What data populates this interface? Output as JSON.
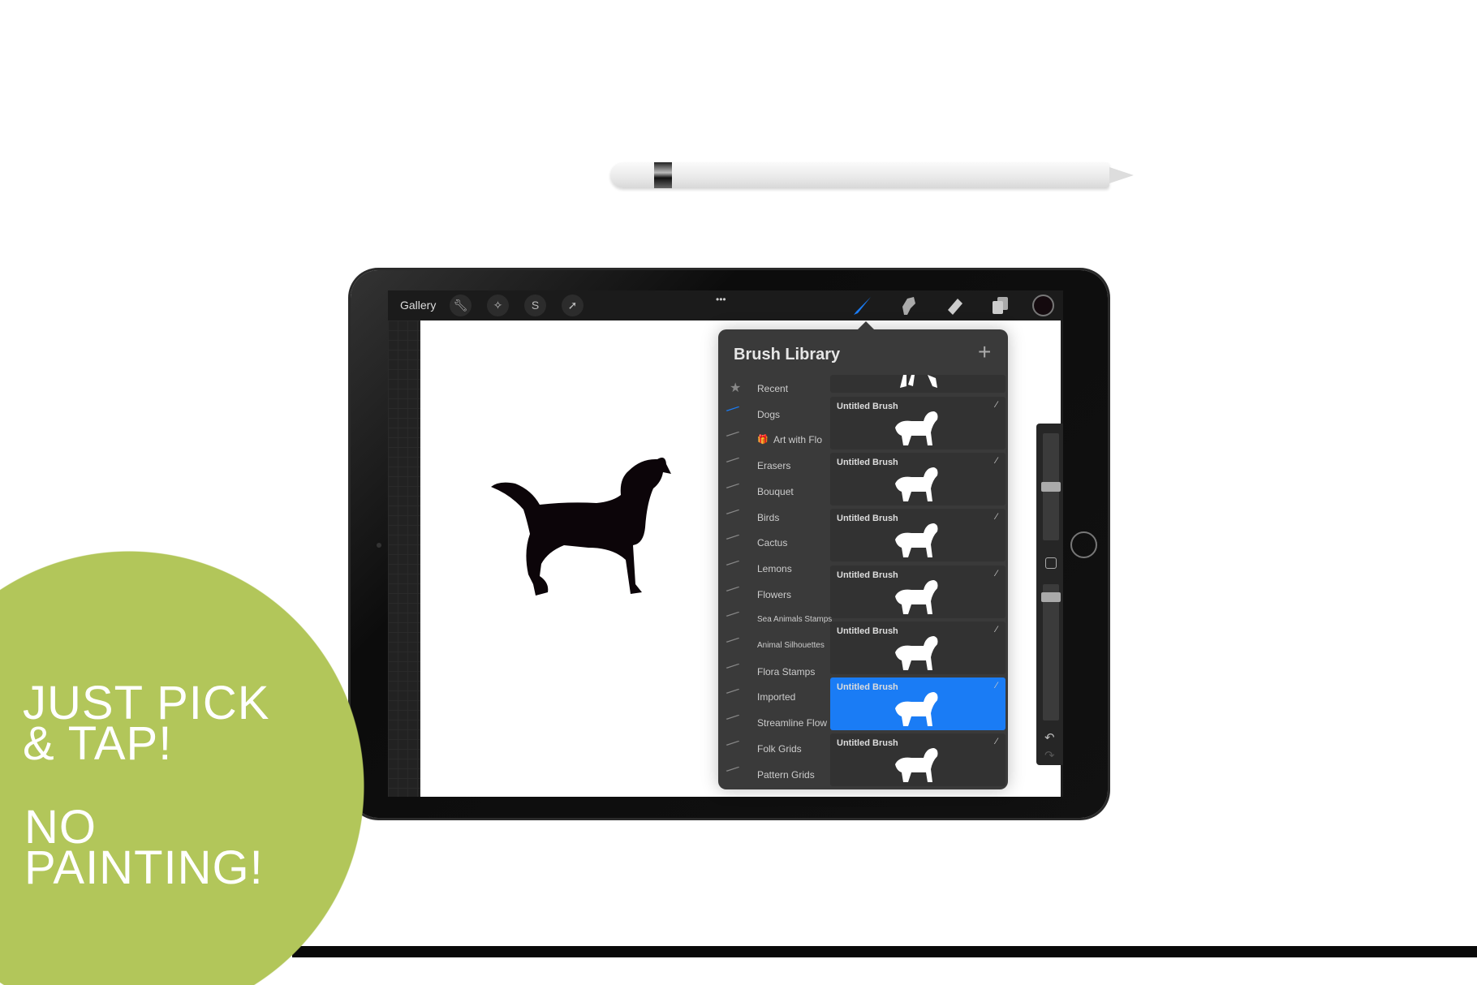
{
  "toolbar": {
    "gallery": "Gallery",
    "more": "•••",
    "left_icons": [
      "wrench-icon",
      "magic-wand-icon",
      "selection-icon",
      "transform-arrow-icon"
    ],
    "right_icons": [
      "brush-icon",
      "smudge-icon",
      "eraser-icon",
      "layers-icon",
      "color-icon"
    ],
    "active_tool_color": "#1a7cf5",
    "current_color": "#140a0e"
  },
  "brush_library": {
    "title": "Brush Library",
    "add": "+",
    "sets": [
      {
        "label": "Recent",
        "icon": "star-icon"
      },
      {
        "label": "Dogs",
        "icon": "brush-stroke-icon",
        "active": true
      },
      {
        "label": "Art with Flo",
        "icon": "gift-icon"
      },
      {
        "label": "Erasers"
      },
      {
        "label": "Bouquet"
      },
      {
        "label": "Birds"
      },
      {
        "label": "Cactus"
      },
      {
        "label": "Lemons"
      },
      {
        "label": "Flowers"
      },
      {
        "label": "Sea Animals Stamps"
      },
      {
        "label": "Animal Silhouettes"
      },
      {
        "label": "Flora Stamps"
      },
      {
        "label": "Imported"
      },
      {
        "label": "Streamline Flow"
      },
      {
        "label": "Folk Grids"
      },
      {
        "label": "Pattern Grids"
      }
    ],
    "brushes": [
      {
        "name": "Untitled Brush"
      },
      {
        "name": "Untitled Brush"
      },
      {
        "name": "Untitled Brush"
      },
      {
        "name": "Untitled Brush"
      },
      {
        "name": "Untitled Brush"
      },
      {
        "name": "Untitled Brush",
        "selected": true
      },
      {
        "name": "Untitled Brush"
      }
    ],
    "selected_color": "#1a7cf5"
  },
  "promo": {
    "line1": "JUST PICK\n& TAP!",
    "line2": "NO\nPAINTING!",
    "circle_color": "#b2c65a"
  }
}
